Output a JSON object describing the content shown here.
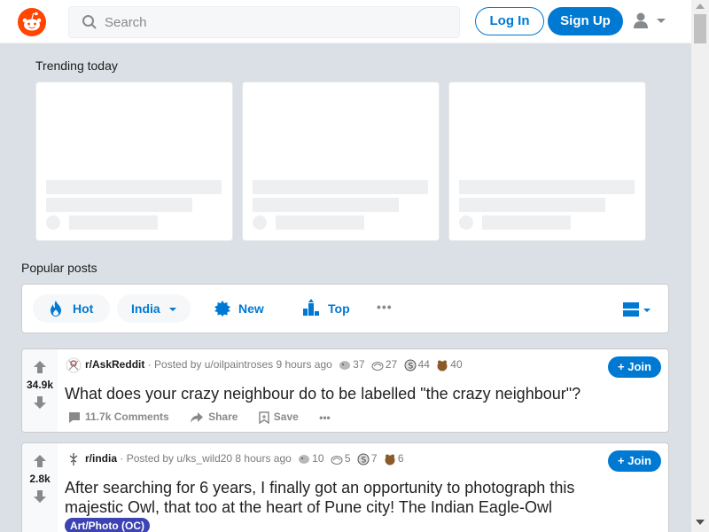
{
  "header": {
    "search_placeholder": "Search",
    "login_label": "Log In",
    "signup_label": "Sign Up",
    "accent_color": "#0079d3",
    "brand_color": "#ff4500"
  },
  "trending": {
    "title": "Trending today"
  },
  "popular": {
    "title": "Popular posts",
    "sort": {
      "hot_label": "Hot",
      "location_label": "India",
      "new_label": "New",
      "top_label": "Top",
      "more_label": "•••"
    }
  },
  "posts": [
    {
      "subreddit": "r/AskReddit",
      "posted_by": "· Posted by u/oilpaintroses 9 hours ago",
      "awards": [
        "37",
        "27",
        "44",
        "40"
      ],
      "votes": "34.9k",
      "title": "What does your crazy neighbour do to be labelled \"the crazy neighbour\"?",
      "join_label": "Join",
      "comments_label": "11.7k Comments",
      "share_label": "Share",
      "save_label": "Save",
      "more_label": "•••"
    },
    {
      "subreddit": "r/india",
      "posted_by": "· Posted by u/ks_wild20 8 hours ago",
      "awards": [
        "10",
        "5",
        "7",
        "6"
      ],
      "votes": "2.8k",
      "title_line1": "After searching for 6 years, I finally got an opportunity to photograph this",
      "title_line2": "majestic Owl, that too at the heart of Pune city! The Indian Eagle-Owl",
      "flair": "Art/Photo (OC)",
      "join_label": "Join"
    }
  ]
}
